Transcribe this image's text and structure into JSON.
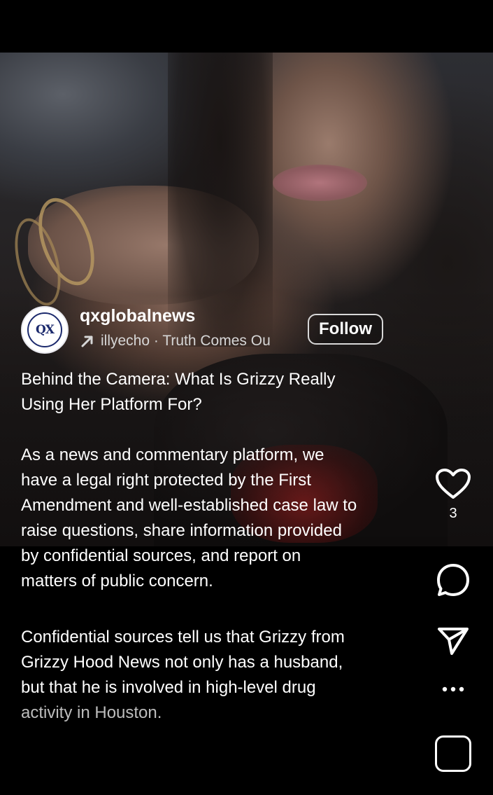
{
  "post": {
    "account": {
      "avatar_text": "QX",
      "username": "qxglobalnews",
      "audio_line": "illyecho · Truth Comes Ou",
      "follow_label": "Follow"
    },
    "caption": {
      "headline_line1": "Behind the Camera: What Is Grizzy Really",
      "headline_line2": "Using Her Platform For?",
      "para2_lines": [
        "As a news and commentary platform, we",
        "have a legal right protected by the First",
        "Amendment and well-established case law to",
        "raise questions, share information provided",
        "by confidential sources, and report on",
        "matters of public concern."
      ],
      "para3_lines": [
        "Confidential sources tell us that Grizzy from",
        "Grizzy Hood News not only has a husband,",
        "but that he is involved in high-level drug",
        "activity in Houston."
      ]
    },
    "actions": {
      "like_icon": "heart-icon",
      "like_count": "3",
      "comment_icon": "comment-icon",
      "share_icon": "send-icon",
      "more_icon": "more-icon",
      "audio_icon": "audio-thumbnail"
    }
  },
  "colors": {
    "background": "#000000",
    "text": "#ffffff",
    "avatar_brand": "#1c2a6d"
  }
}
